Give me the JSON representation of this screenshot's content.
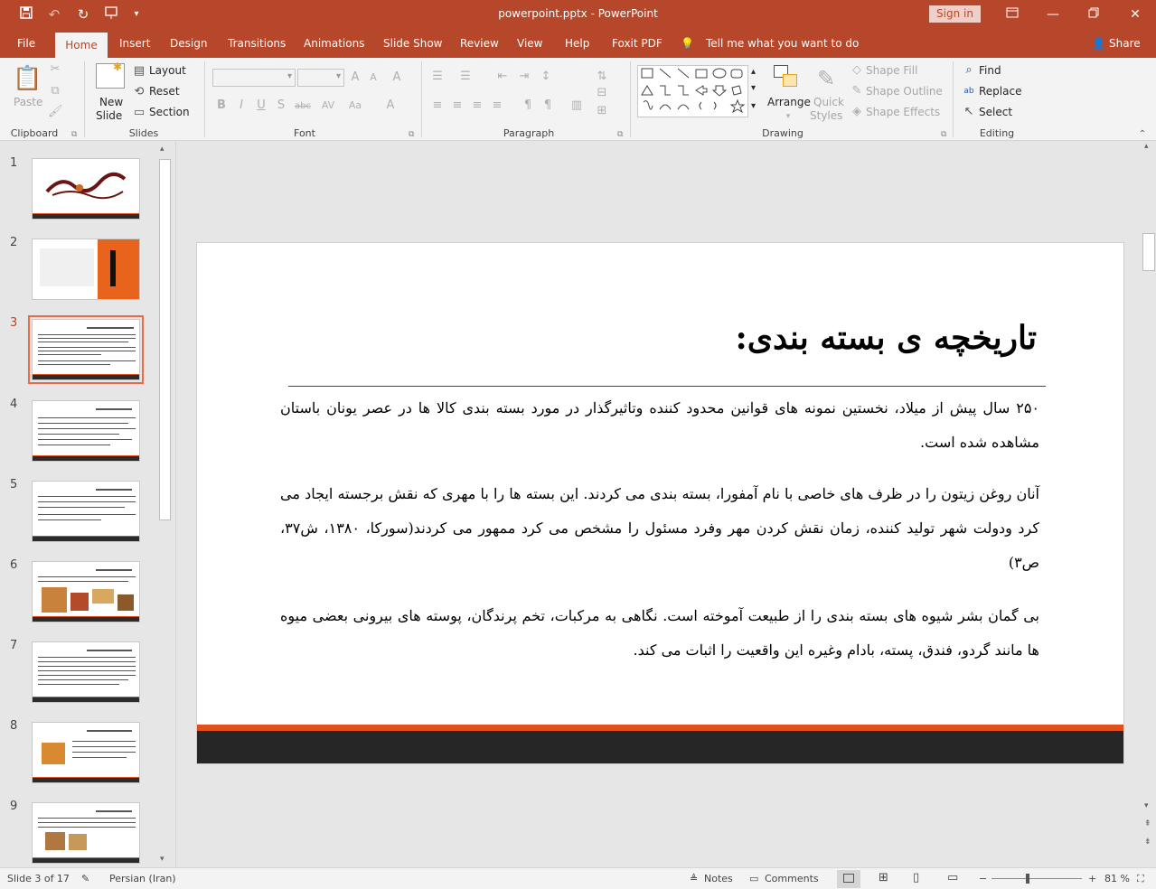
{
  "window": {
    "title": "powerpoint.pptx  -  PowerPoint",
    "sign_in": "Sign in",
    "icons": [
      "save-icon",
      "undo-icon",
      "redo-icon",
      "start-from-beginning-icon",
      "customize-qat-icon",
      "ribbon-display-options-icon",
      "minimize-icon",
      "restore-icon",
      "close-icon"
    ]
  },
  "tabs": {
    "file": "File",
    "home": "Home",
    "insert": "Insert",
    "design": "Design",
    "transitions": "Transitions",
    "animations": "Animations",
    "slide_show": "Slide Show",
    "review": "Review",
    "view": "View",
    "help": "Help",
    "foxit": "Foxit PDF",
    "tell_me": "Tell me what you want to do",
    "share": "Share"
  },
  "ribbon": {
    "clipboard": {
      "label": "Clipboard",
      "paste": "Paste"
    },
    "slides": {
      "label": "Slides",
      "new_slide_1": "New",
      "new_slide_2": "Slide",
      "layout": "Layout",
      "reset": "Reset",
      "section": "Section"
    },
    "font": {
      "label": "Font"
    },
    "paragraph": {
      "label": "Paragraph"
    },
    "drawing": {
      "label": "Drawing",
      "arrange": "Arrange",
      "quick_1": "Quick",
      "quick_2": "Styles",
      "shape_fill": "Shape Fill",
      "shape_outline": "Shape Outline",
      "shape_effects": "Shape Effects"
    },
    "editing": {
      "label": "Editing",
      "find": "Find",
      "replace": "Replace",
      "select": "Select"
    }
  },
  "thumbnails": {
    "numbers": [
      "1",
      "2",
      "3",
      "4",
      "5",
      "6",
      "7",
      "8",
      "9"
    ],
    "selected_index": 3
  },
  "slide": {
    "title": "تاریخچه ی بسته بندی:",
    "paragraphs": [
      "۲۵۰ سال پیش از میلاد، نخستین نمونه های قوانین محدود کننده وتاثیرگذار در مورد بسته بندی کالا ها در عصر یونان باستان مشاهده شده است.",
      "آنان روغن زیتون را در ظرف های خاصی با نام آمفورا، بسته بندی می کردند. این بسته ها را با مهری که نقش برجسته ایجاد می کرد ودولت شهر تولید کننده، زمان نقش کردن مهر وفرد مسئول را مشخص می کرد ممهور می کردند(سورکا، ۱۳۸۰، ش۳۷، ص۳)",
      "بی گمان بشر شیوه های بسته بندی را از طبیعت آموخته است. نگاهی به مرکبات، تخم پرندگان، پوسته های بیرونی بعضی میوه ها مانند گردو، فندق، پسته، بادام وغیره این واقعیت را اثبات می کند."
    ]
  },
  "status": {
    "slide_info": "Slide 3 of 17",
    "language": "Persian (Iran)",
    "notes": "Notes",
    "comments": "Comments",
    "zoom": "81 %"
  },
  "colors": {
    "accent": "#b7472a",
    "slide_stripe": "#e0501e",
    "slide_footer": "#262626"
  }
}
